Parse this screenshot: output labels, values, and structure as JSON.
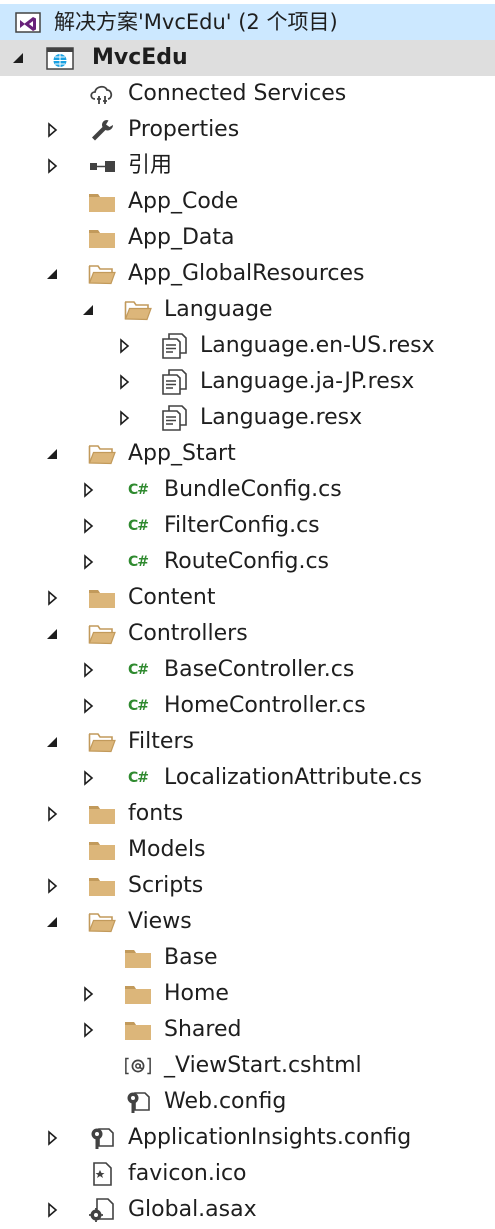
{
  "solution": {
    "label": "解决方案'MvcEdu' (2 个项目)"
  },
  "items": [
    {
      "label": "MvcEdu",
      "level": 0,
      "expander": "expanded",
      "icon": "web-project-icon",
      "bold": true
    },
    {
      "label": "Connected Services",
      "level": 1,
      "expander": "none",
      "icon": "connected-services-icon"
    },
    {
      "label": "Properties",
      "level": 1,
      "expander": "collapsed",
      "icon": "wrench-icon"
    },
    {
      "label": "引用",
      "level": 1,
      "expander": "collapsed",
      "icon": "references-icon"
    },
    {
      "label": "App_Code",
      "level": 1,
      "expander": "none",
      "icon": "folder-icon"
    },
    {
      "label": "App_Data",
      "level": 1,
      "expander": "none",
      "icon": "folder-icon"
    },
    {
      "label": "App_GlobalResources",
      "level": 1,
      "expander": "expanded",
      "icon": "folder-open-icon"
    },
    {
      "label": "Language",
      "level": 2,
      "expander": "expanded",
      "icon": "folder-open-icon"
    },
    {
      "label": "Language.en-US.resx",
      "level": 3,
      "expander": "collapsed",
      "icon": "resx-file-icon"
    },
    {
      "label": "Language.ja-JP.resx",
      "level": 3,
      "expander": "collapsed",
      "icon": "resx-file-icon"
    },
    {
      "label": "Language.resx",
      "level": 3,
      "expander": "collapsed",
      "icon": "resx-file-icon"
    },
    {
      "label": "App_Start",
      "level": 1,
      "expander": "expanded",
      "icon": "folder-open-icon"
    },
    {
      "label": "BundleConfig.cs",
      "level": 2,
      "expander": "collapsed",
      "icon": "csharp-file-icon"
    },
    {
      "label": "FilterConfig.cs",
      "level": 2,
      "expander": "collapsed",
      "icon": "csharp-file-icon"
    },
    {
      "label": "RouteConfig.cs",
      "level": 2,
      "expander": "collapsed",
      "icon": "csharp-file-icon"
    },
    {
      "label": "Content",
      "level": 1,
      "expander": "collapsed",
      "icon": "folder-icon"
    },
    {
      "label": "Controllers",
      "level": 1,
      "expander": "expanded",
      "icon": "folder-open-icon"
    },
    {
      "label": "BaseController.cs",
      "level": 2,
      "expander": "collapsed",
      "icon": "csharp-file-icon"
    },
    {
      "label": "HomeController.cs",
      "level": 2,
      "expander": "collapsed",
      "icon": "csharp-file-icon"
    },
    {
      "label": "Filters",
      "level": 1,
      "expander": "expanded",
      "icon": "folder-open-icon"
    },
    {
      "label": "LocalizationAttribute.cs",
      "level": 2,
      "expander": "collapsed",
      "icon": "csharp-file-icon"
    },
    {
      "label": "fonts",
      "level": 1,
      "expander": "collapsed",
      "icon": "folder-icon"
    },
    {
      "label": "Models",
      "level": 1,
      "expander": "none",
      "icon": "folder-icon"
    },
    {
      "label": "Scripts",
      "level": 1,
      "expander": "collapsed",
      "icon": "folder-icon"
    },
    {
      "label": "Views",
      "level": 1,
      "expander": "expanded",
      "icon": "folder-open-icon"
    },
    {
      "label": "Base",
      "level": 2,
      "expander": "none",
      "icon": "folder-icon"
    },
    {
      "label": "Home",
      "level": 2,
      "expander": "collapsed",
      "icon": "folder-icon"
    },
    {
      "label": "Shared",
      "level": 2,
      "expander": "collapsed",
      "icon": "folder-icon"
    },
    {
      "label": "_ViewStart.cshtml",
      "level": 2,
      "expander": "none",
      "icon": "razor-file-icon"
    },
    {
      "label": "Web.config",
      "level": 2,
      "expander": "none",
      "icon": "config-file-icon"
    },
    {
      "label": "ApplicationInsights.config",
      "level": 1,
      "expander": "collapsed",
      "icon": "config-file-icon"
    },
    {
      "label": "favicon.ico",
      "level": 1,
      "expander": "none",
      "icon": "ico-file-icon"
    },
    {
      "label": "Global.asax",
      "level": 1,
      "expander": "collapsed",
      "icon": "asax-file-icon"
    }
  ],
  "colors": {
    "folder": "#dcb67a",
    "folder_dark": "#c29a5b",
    "csharp": "#2f8a2f",
    "vs_purple": "#68217a",
    "globe": "#1ba1e2",
    "icon_dark": "#424242",
    "root_bg": "#dedede"
  }
}
